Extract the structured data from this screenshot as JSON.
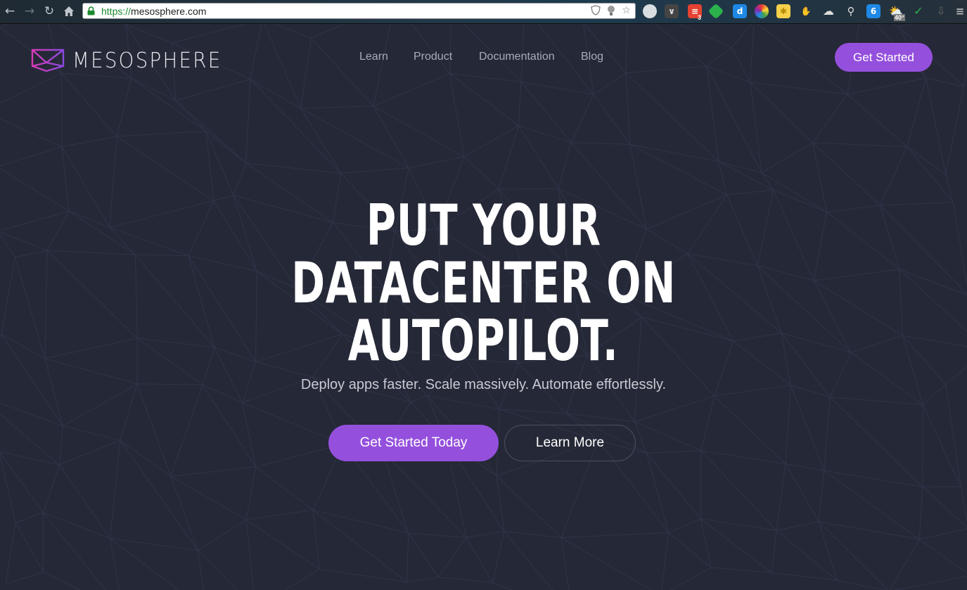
{
  "browser": {
    "url_scheme": "https://",
    "url_host": "mesosphere.com",
    "extension_badge_count": "3",
    "weather_temp": "40°"
  },
  "site": {
    "brand": "MESOSPHERE",
    "nav": [
      "Learn",
      "Product",
      "Documentation",
      "Blog"
    ],
    "cta_label": "Get Started"
  },
  "hero": {
    "lines": [
      "PUT YOUR",
      "DATACENTER ON",
      "AUTOPILOT."
    ],
    "subtitle": "Deploy apps faster. Scale massively. Automate effortlessly.",
    "primary_label": "Get Started Today",
    "secondary_label": "Learn More"
  },
  "colors": {
    "background": "#252836",
    "accent": "#9450dd",
    "logo_magenta": "#d43ab4",
    "logo_violet": "#8a4ae0"
  }
}
